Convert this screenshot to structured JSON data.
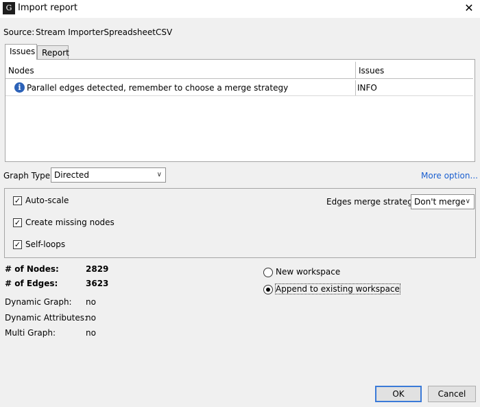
{
  "window": {
    "title": "Import report",
    "close_glyph": "✕"
  },
  "source": {
    "label": "Source:",
    "value": "Stream ImporterSpreadsheetCSV"
  },
  "tabs": [
    {
      "label": "Issues",
      "active": true
    },
    {
      "label": "Report",
      "active": false
    }
  ],
  "issues_table": {
    "columns": [
      "Nodes",
      "Issues"
    ],
    "rows": [
      {
        "icon": "info-icon",
        "message": "Parallel edges detected, remember to choose a merge strategy",
        "level": "INFO"
      }
    ]
  },
  "graph_type": {
    "label": "Graph Type:",
    "selected": "Directed"
  },
  "more_options": "More option...",
  "options": {
    "auto_scale": {
      "label": "Auto-scale",
      "checked": true
    },
    "create_missing_nodes": {
      "label": "Create missing nodes",
      "checked": true
    },
    "self_loops": {
      "label": "Self-loops",
      "checked": true
    },
    "edges_merge_strategy": {
      "label": "Edges merge strategy:",
      "selected": "Don't merge"
    }
  },
  "stats": {
    "nodes": {
      "label": "# of Nodes:",
      "value": "2829"
    },
    "edges": {
      "label": "# of Edges:",
      "value": "3623"
    },
    "dynamic_graph": {
      "label": "Dynamic Graph:",
      "value": "no"
    },
    "dynamic_attributes": {
      "label": "Dynamic Attributes:",
      "value": "no"
    },
    "multi_graph": {
      "label": "Multi Graph:",
      "value": "no"
    }
  },
  "workspace": {
    "new": {
      "label": "New workspace",
      "selected": false
    },
    "append": {
      "label": "Append to existing workspace",
      "selected": true
    }
  },
  "buttons": {
    "ok": "OK",
    "cancel": "Cancel"
  },
  "colors": {
    "link": "#1a5fd0",
    "info_icon": "#2c62b8",
    "default_button_border": "#3a7ad8"
  }
}
